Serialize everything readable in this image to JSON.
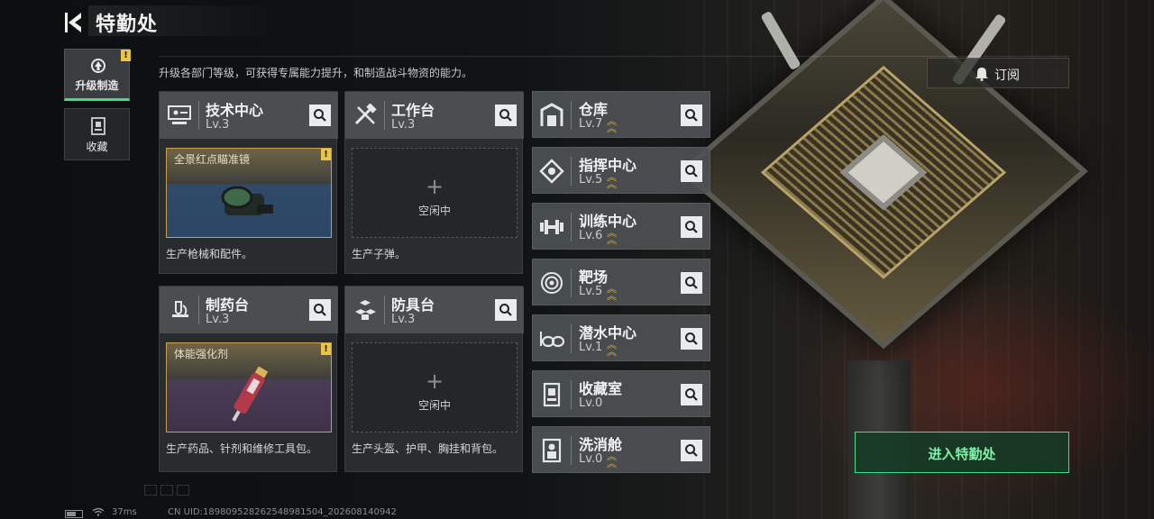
{
  "header": {
    "title": "特勤处",
    "subtitle": "升级各部门等级，可获得专属能力提升，和制造战斗物资的能力。"
  },
  "tabs": [
    {
      "label": "升级制造",
      "icon": "upgrade-icon",
      "active": true,
      "badge": "!"
    },
    {
      "label": "收藏",
      "icon": "collection-icon",
      "active": false
    }
  ],
  "subscribe": {
    "label": "订阅",
    "icon": "bell-icon"
  },
  "facilities": [
    {
      "name": "技术中心",
      "level": "Lv.3",
      "icon": "tech-center-icon",
      "slot": {
        "state": "busy",
        "item": "全景红点瞄准镜",
        "badge": "!"
      },
      "desc": "生产枪械和配件。"
    },
    {
      "name": "工作台",
      "level": "Lv.3",
      "icon": "workbench-icon",
      "slot": {
        "state": "idle",
        "label": "空闲中"
      },
      "desc": "生产子弹。"
    },
    {
      "name": "制药台",
      "level": "Lv.3",
      "icon": "pharmacy-icon",
      "slot": {
        "state": "busy",
        "item": "体能强化剂",
        "badge": "!"
      },
      "desc": "生产药品、针剂和维修工具包。"
    },
    {
      "name": "防具台",
      "level": "Lv.3",
      "icon": "armor-bench-icon",
      "slot": {
        "state": "idle",
        "label": "空闲中"
      },
      "desc": "生产头盔、护甲、胸挂和背包。"
    }
  ],
  "departments": [
    {
      "name": "仓库",
      "level": "Lv.7",
      "icon": "warehouse-icon"
    },
    {
      "name": "指挥中心",
      "level": "Lv.5",
      "icon": "command-center-icon"
    },
    {
      "name": "训练中心",
      "level": "Lv.6",
      "icon": "dumbbell-icon"
    },
    {
      "name": "靶场",
      "level": "Lv.5",
      "icon": "target-icon"
    },
    {
      "name": "潜水中心",
      "level": "Lv.1",
      "icon": "diving-goggles-icon"
    },
    {
      "name": "收藏室",
      "level": "Lv.0",
      "icon": "collection-room-icon"
    },
    {
      "name": "洗消舱",
      "level": "Lv.0",
      "icon": "decontamination-icon"
    }
  ],
  "enter_button": {
    "label": "进入特勤处"
  },
  "footer": {
    "ping": "37ms",
    "uid": "CN UID:1898095282625489815​04_202608140942"
  },
  "colors": {
    "accent_green": "#3fe08a",
    "badge_yellow": "#e9c44a",
    "level_chevron": "#e3b341"
  }
}
